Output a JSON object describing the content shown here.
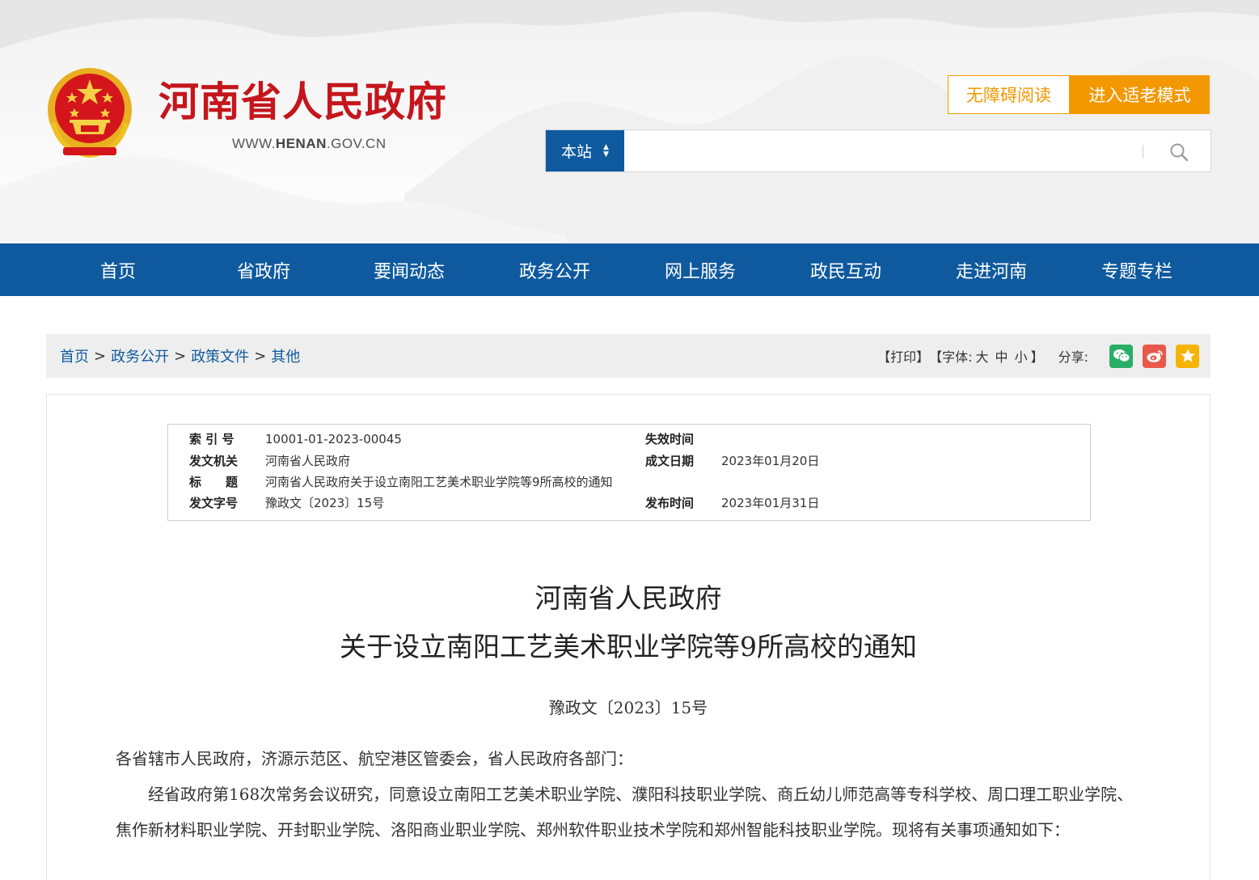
{
  "header": {
    "site_title": "河南省人民政府",
    "url_prefix": "WWW.",
    "url_bold": "HENAN",
    "url_suffix": ".GOV.CN",
    "accessibility_button": "无障碍阅读",
    "elder_mode_button": "进入适老模式",
    "search_scope": "本站",
    "search_placeholder": "",
    "icons": [
      "national-emblem-icon",
      "search-icon"
    ]
  },
  "nav": {
    "items": [
      "首页",
      "省政府",
      "要闻动态",
      "政务公开",
      "网上服务",
      "政民互动",
      "走进河南",
      "专题专栏"
    ]
  },
  "breadcrumb": {
    "items": [
      "首页",
      "政务公开",
      "政策文件",
      "其他"
    ],
    "separator": ">"
  },
  "tools": {
    "print": "【打印】",
    "font_label": "【字体:",
    "font_large": "大",
    "font_medium": "中",
    "font_small": "小",
    "font_close": "】",
    "share_label": "分享:",
    "share_icons": [
      "wechat-icon",
      "weibo-icon",
      "favorite-star-icon"
    ]
  },
  "meta": {
    "index_label": "索 引 号",
    "index_value": "10001-01-2023-00045",
    "expire_label": "失效时间",
    "expire_value": "",
    "issuer_label": "发文机关",
    "issuer_value": "河南省人民政府",
    "written_label": "成文日期",
    "written_value": "2023年01月20日",
    "title_label": "标　　题",
    "title_value": "河南省人民政府关于设立南阳工艺美术职业学院等9所高校的通知",
    "docno_label": "发文字号",
    "docno_value": "豫政文〔2023〕15号",
    "publish_label": "发布时间",
    "publish_value": "2023年01月31日"
  },
  "document": {
    "title_line1": "河南省人民政府",
    "title_line2": "关于设立南阳工艺美术职业学院等9所高校的通知",
    "number": "豫政文〔2023〕15号",
    "salutation": "各省辖市人民政府，济源示范区、航空港区管委会，省人民政府各部门：",
    "paragraph1": "经省政府第168次常务会议研究，同意设立南阳工艺美术职业学院、濮阳科技职业学院、商丘幼儿师范高等专科学校、周口理工职业学院、焦作新材料职业学院、开封职业学院、洛阳商业职业学院、郑州软件职业技术学院和郑州智能科技职业学院。现将有关事项通知如下："
  },
  "colors": {
    "brand_red": "#c4161c",
    "nav_blue": "#0f5a9e",
    "orange": "#f39800",
    "wechat_green": "#2aae67",
    "weibo_red": "#e8594c",
    "star_yellow": "#f5b400"
  }
}
